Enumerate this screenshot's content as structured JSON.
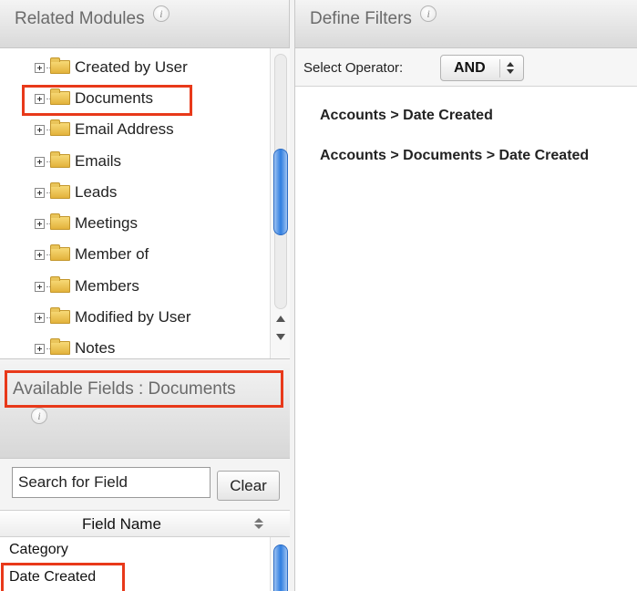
{
  "related_modules": {
    "title": "Related Modules",
    "items": [
      {
        "label": "Created by User"
      },
      {
        "label": "Documents"
      },
      {
        "label": "Email Address"
      },
      {
        "label": "Emails"
      },
      {
        "label": "Leads"
      },
      {
        "label": "Meetings"
      },
      {
        "label": "Member of"
      },
      {
        "label": "Members"
      },
      {
        "label": "Modified by User"
      },
      {
        "label": "Notes"
      }
    ]
  },
  "available_fields": {
    "title": "Available Fields : Documents",
    "search": {
      "value": "",
      "placeholder": "Search for Field"
    },
    "clear_label": "Clear",
    "column_header": "Field Name",
    "rows": [
      {
        "label": "Category"
      },
      {
        "label": "Date Created"
      }
    ]
  },
  "define_filters": {
    "title": "Define Filters",
    "operator_label": "Select Operator:",
    "operator_value": "AND",
    "filters": [
      {
        "label": "Accounts > Date Created"
      },
      {
        "label": "Accounts > Documents > Date Created"
      }
    ]
  },
  "info_glyph": "i",
  "colors": {
    "highlight": "#e8391a",
    "scroll_thumb": "#2f7ee0",
    "folder": "#e3b23c"
  }
}
